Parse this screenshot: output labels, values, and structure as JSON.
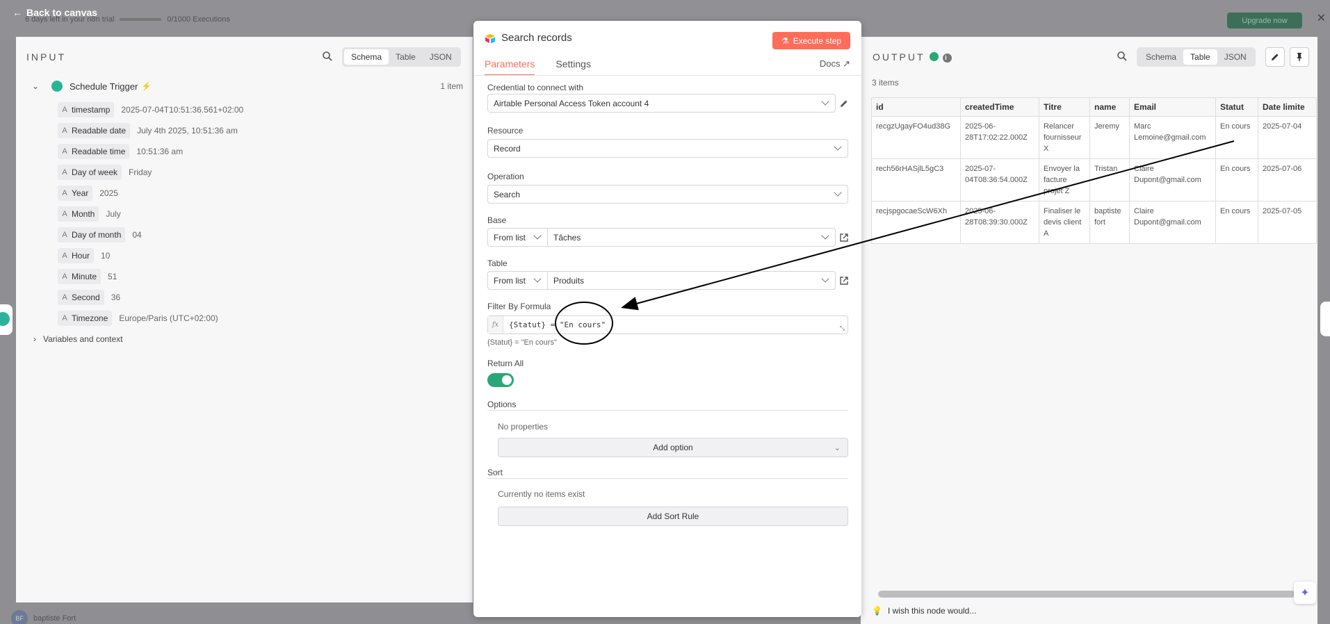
{
  "background": {
    "trial_text": "6 days left in your n8n trial",
    "executions": "0/1000 Executions",
    "upgrade_label": "Upgrade now",
    "user_name": "baptiste Fort",
    "user_initials": "BF"
  },
  "back_label": "Back to canvas",
  "input": {
    "title": "INPUT",
    "views": [
      "Schema",
      "Table",
      "JSON"
    ],
    "active_view": "Schema",
    "trigger_name": "Schedule Trigger",
    "item_count": "1 item",
    "fields": [
      {
        "type": "A",
        "key": "timestamp",
        "value": "2025-07-04T10:51:36.561+02:00"
      },
      {
        "type": "A",
        "key": "Readable date",
        "value": "July 4th 2025, 10:51:36 am"
      },
      {
        "type": "A",
        "key": "Readable time",
        "value": "10:51:36 am"
      },
      {
        "type": "A",
        "key": "Day of week",
        "value": "Friday"
      },
      {
        "type": "A",
        "key": "Year",
        "value": "2025"
      },
      {
        "type": "A",
        "key": "Month",
        "value": "July"
      },
      {
        "type": "A",
        "key": "Day of month",
        "value": "04"
      },
      {
        "type": "A",
        "key": "Hour",
        "value": "10"
      },
      {
        "type": "A",
        "key": "Minute",
        "value": "51"
      },
      {
        "type": "A",
        "key": "Second",
        "value": "36"
      },
      {
        "type": "A",
        "key": "Timezone",
        "value": "Europe/Paris (UTC+02:00)"
      }
    ],
    "variables_label": "Variables and context"
  },
  "node": {
    "title": "Search records",
    "execute_label": "Execute step",
    "tabs": [
      "Parameters",
      "Settings"
    ],
    "active_tab": "Parameters",
    "docs_label": "Docs",
    "credential_label": "Credential to connect with",
    "credential_value": "Airtable Personal Access Token account 4",
    "resource_label": "Resource",
    "resource_value": "Record",
    "operation_label": "Operation",
    "operation_value": "Search",
    "base_label": "Base",
    "base_mode": "From list",
    "base_value": "Tâches",
    "table_label": "Table",
    "table_mode": "From list",
    "table_value": "Produits",
    "filter_label": "Filter By Formula",
    "filter_value": "{Statut} = \"En cours\"",
    "filter_hint": "{Statut} = \"En cours\"",
    "return_all_label": "Return All",
    "return_all": true,
    "options_label": "Options",
    "options_empty": "No properties",
    "add_option_label": "Add option",
    "sort_label": "Sort",
    "sort_empty": "Currently no items exist",
    "add_sort_label": "Add Sort Rule"
  },
  "output": {
    "title": "OUTPUT",
    "views": [
      "Schema",
      "Table",
      "JSON"
    ],
    "active_view": "Table",
    "items_count": "3 items",
    "columns": [
      "id",
      "createdTime",
      "Titre",
      "name",
      "Email",
      "Statut",
      "Date limite"
    ],
    "rows": [
      [
        "recgzUgayFO4ud38G",
        "2025-06-28T17:02:22.000Z",
        "Relancer fournisseur X",
        "Jeremy",
        "Marc Lemoine@gmail.com",
        "En cours",
        "2025-07-04"
      ],
      [
        "rech56rHASjlL5gC3",
        "2025-07-04T08:36:54.000Z",
        "Envoyer la facture projet Z",
        "Tristan",
        "Claire Dupont@gmail.com",
        "En cours",
        "2025-07-06"
      ],
      [
        "recjspgocaeScW6Xh",
        "2025-06-28T08:39:30.000Z",
        "Finaliser le devis client A",
        "baptiste fort",
        "Claire Dupont@gmail.com",
        "En cours",
        "2025-07-05"
      ]
    ],
    "feedback_label": "I wish this node would..."
  },
  "colors": {
    "accent": "#ff6d5a",
    "success": "#29a876",
    "trigger": "#2cb49b"
  }
}
